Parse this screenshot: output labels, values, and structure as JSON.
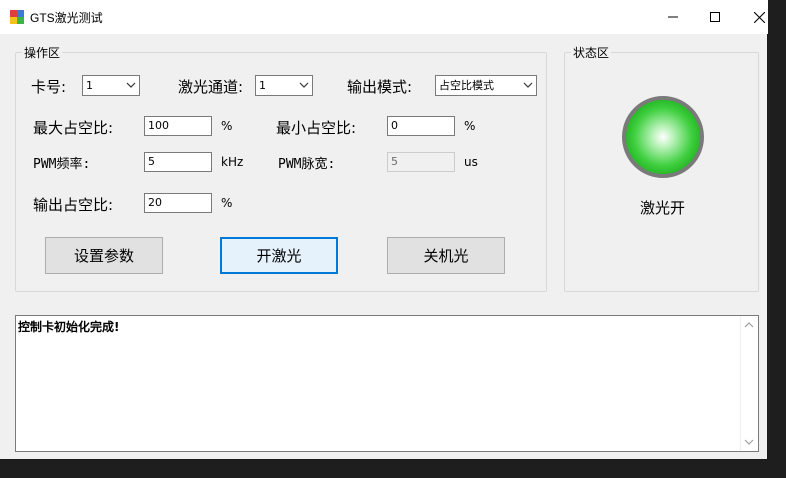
{
  "window": {
    "title": "GTS激光测试"
  },
  "ops_group": {
    "title": "操作区",
    "card_label": "卡号:",
    "card_value": "1",
    "channel_label": "激光通道:",
    "channel_value": "1",
    "mode_label": "输出模式:",
    "mode_value": "占空比模式",
    "max_duty_label": "最大占空比:",
    "max_duty_value": "100",
    "max_duty_unit": "%",
    "min_duty_label": "最小占空比:",
    "min_duty_value": "0",
    "min_duty_unit": "%",
    "pwm_freq_label": "PWM频率:",
    "pwm_freq_value": "5",
    "pwm_freq_unit": "kHz",
    "pwm_width_label": "PWM脉宽:",
    "pwm_width_value": "5",
    "pwm_width_unit": "us",
    "out_duty_label": "输出占空比:",
    "out_duty_value": "20",
    "out_duty_unit": "%",
    "btn_set": "设置参数",
    "btn_on": "开激光",
    "btn_off": "关机光"
  },
  "status_group": {
    "title": "状态区",
    "led_label": "激光开",
    "led_color": "#2ecc40"
  },
  "log": {
    "text": "控制卡初始化完成!"
  }
}
